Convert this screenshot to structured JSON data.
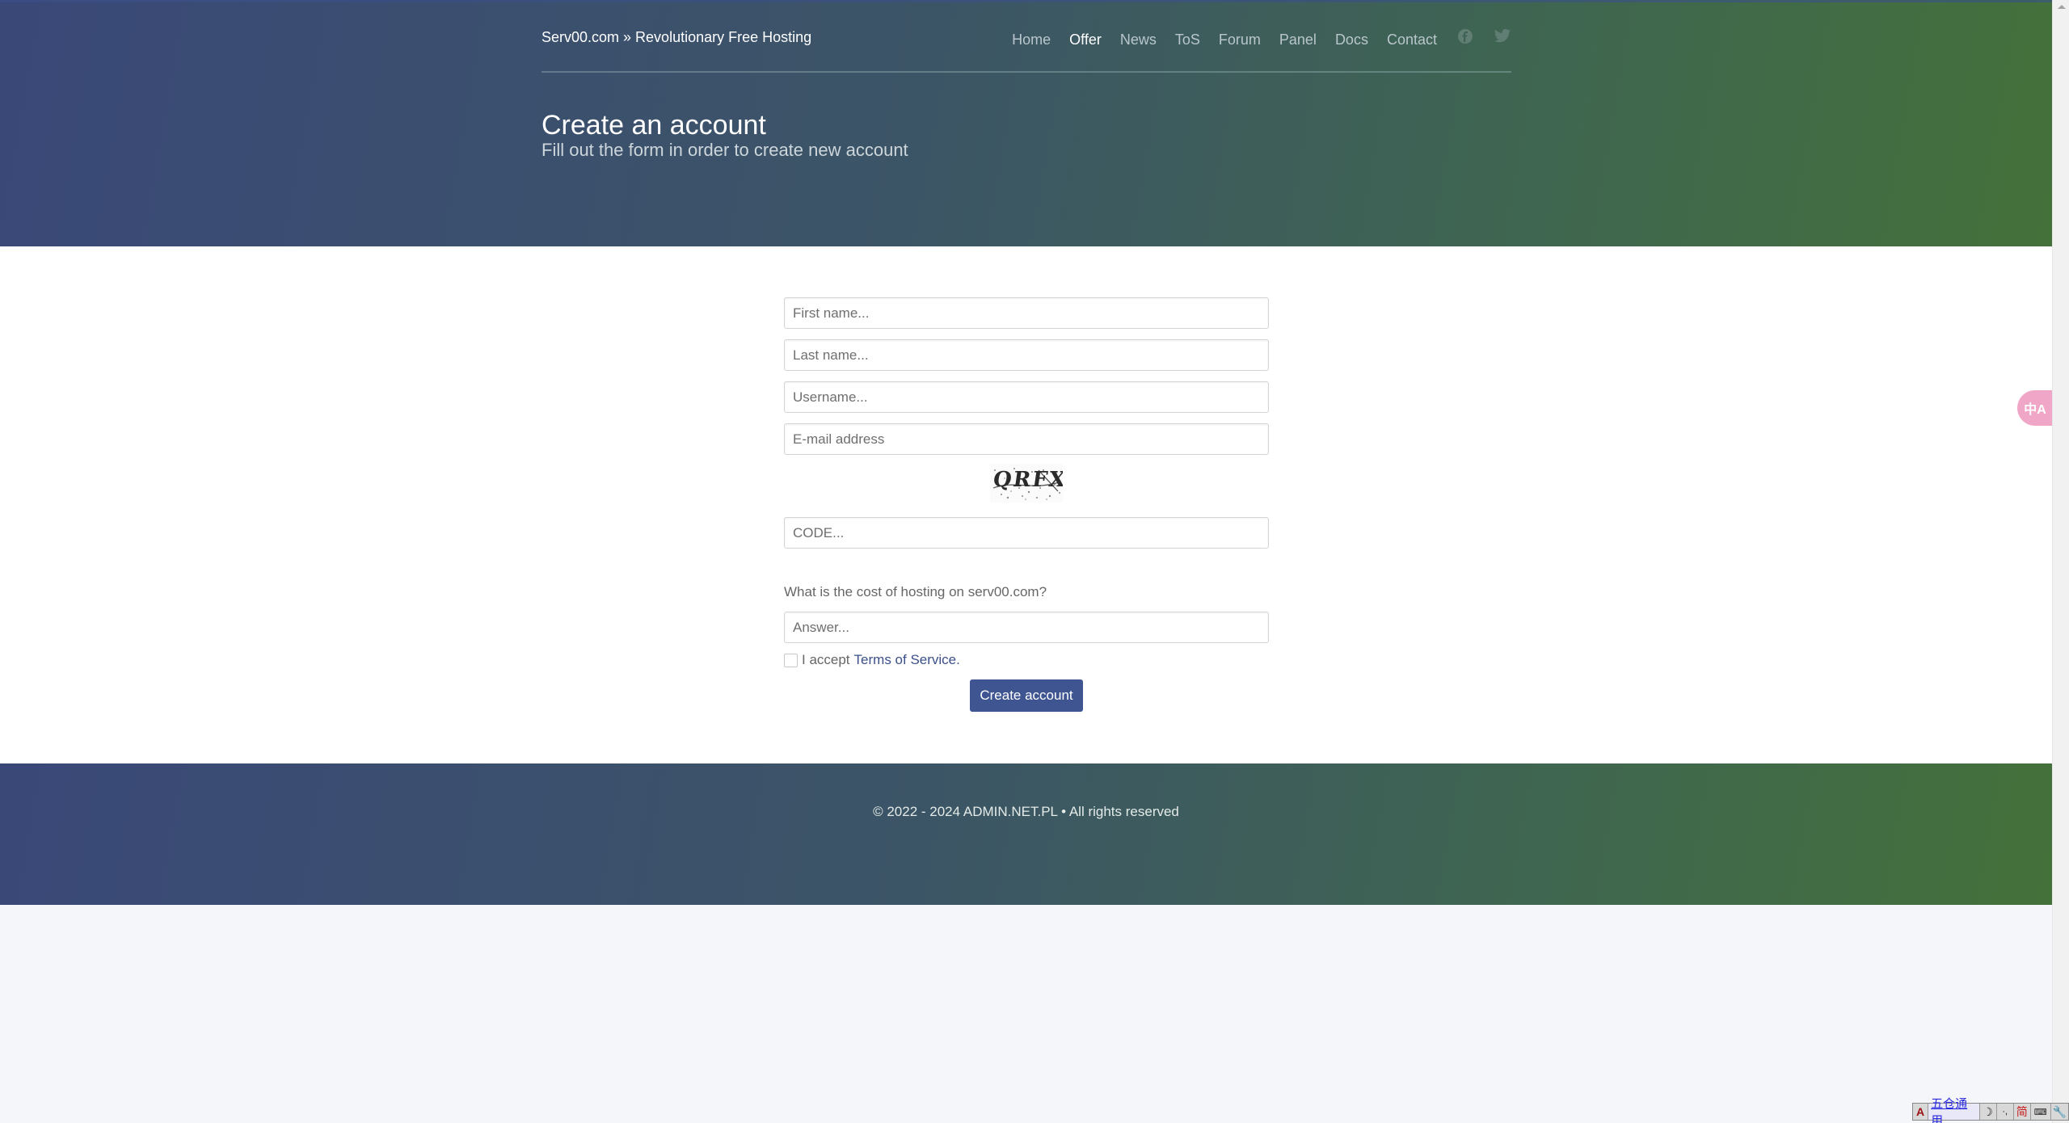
{
  "header": {
    "brand": "Serv00.com » Revolutionary Free Hosting",
    "nav": [
      {
        "label": "Home",
        "active": false
      },
      {
        "label": "Offer",
        "active": true
      },
      {
        "label": "News",
        "active": false
      },
      {
        "label": "ToS",
        "active": false
      },
      {
        "label": "Forum",
        "active": false
      },
      {
        "label": "Panel",
        "active": false
      },
      {
        "label": "Docs",
        "active": false
      },
      {
        "label": "Contact",
        "active": false
      }
    ],
    "social": [
      "facebook-icon",
      "twitter-icon"
    ],
    "title": "Create an account",
    "subtitle": "Fill out the form in order to create new account"
  },
  "form": {
    "first_name_placeholder": "First name...",
    "last_name_placeholder": "Last name...",
    "username_placeholder": "Username...",
    "email_placeholder": "E-mail address",
    "captcha_text": "QRFX",
    "code_placeholder": "CODE...",
    "question": "What is the cost of hosting on serv00.com?",
    "answer_placeholder": "Answer...",
    "terms_prefix": "I accept",
    "terms_link": "Terms of Service",
    "terms_suffix": ".",
    "terms_checked": false,
    "submit_label": "Create account"
  },
  "footer": {
    "copyright": "© 2022 - 2024 ADMIN.NET.PL • All rights reserved"
  },
  "widgets": {
    "translate_label": "中A",
    "ime": {
      "lang": "A",
      "mode": "五仓通用",
      "moon": "☽",
      "punct": "·,",
      "simplified": "简",
      "keyboard": "⌨",
      "tool": "🔧"
    }
  },
  "colors": {
    "gradient_start": "#3a4878",
    "gradient_end": "#44713a",
    "button": "#3f5591",
    "link": "#3b5088"
  }
}
